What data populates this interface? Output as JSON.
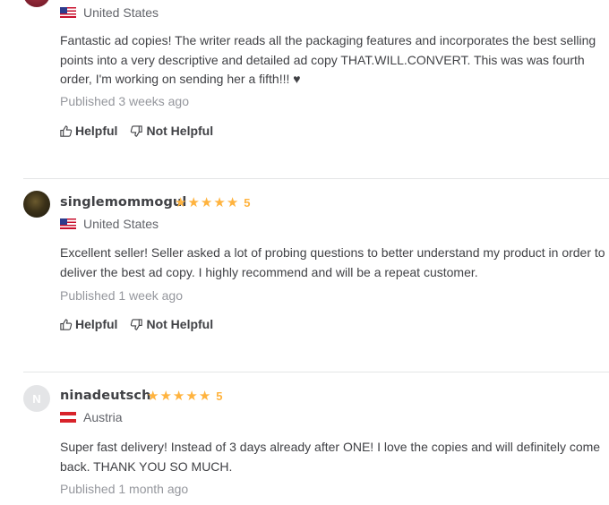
{
  "reviews": [
    {
      "avatar": "photo",
      "username": "",
      "country": "United States",
      "flag": "us-flag-icon",
      "text": "Fantastic ad copies! The writer reads all the packaging features and incorporates the best selling points into a very descriptive and detailed ad copy THAT.WILL.CONVERT. This was was fourth order, I'm working on sending her a fifth!!! ♥",
      "published": "Published 3 weeks ago",
      "helpful_label": "Helpful",
      "not_helpful_label": "Not Helpful"
    },
    {
      "avatar": "photo",
      "username": "singlemommogul",
      "rating": "5",
      "country": "United States",
      "flag": "us-flag-icon",
      "text": "Excellent seller! Seller asked a lot of probing questions to better understand my product in order to deliver the best ad copy. I highly recommend and will be a repeat customer.",
      "published": "Published 1 week ago",
      "helpful_label": "Helpful",
      "not_helpful_label": "Not Helpful"
    },
    {
      "avatar_letter": "N",
      "username": "ninadeutsch",
      "rating": "5",
      "country": "Austria",
      "flag": "at-flag-icon",
      "text": "Super fast delivery! Instead of 3 days already after ONE! I love the copies and will definitely come back. THANK YOU SO MUCH.",
      "published": "Published 1 month ago"
    }
  ],
  "colors": {
    "star": "#ffb33e",
    "text": "#404145",
    "muted": "#95979d",
    "divider": "#e4e5e7"
  }
}
